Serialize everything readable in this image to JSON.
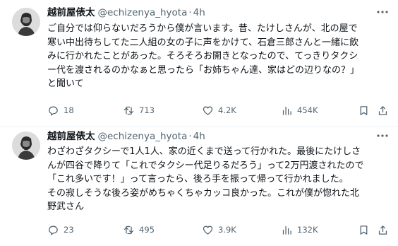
{
  "tweets": [
    {
      "author_name": "越前屋俵太",
      "handle": "@echizenya_hyota",
      "separator": "·",
      "time": "4h",
      "text": "ご自分では仰らないだろうから僕が言います。昔、たけしさんが、北の屋で\n寒い中出待ちしてた二人組の女の子に声をかけて、石倉三郎さんと一緒に飲\nみに行かれたことがあった。そろそろお開きとなったので、てっきりタクシ\nー代を渡されるのかなぁと思ったら「お姉ちゃん達、家はどの辺りなの？」\nと聞いて",
      "replies": "18",
      "reposts": "713",
      "likes": "4.2K",
      "views": "454K"
    },
    {
      "author_name": "越前屋俵太",
      "handle": "@echizenya_hyota",
      "separator": "·",
      "time": "4h",
      "text": "わざわざタクシーで1人1人、家の近くまで送って行かれた。最後にたけしさ\nんが四谷で降りて「これでタクシー代足りるだろう」って2万円渡されたので\n「これ多いです！」って言ったら、後ろ手を振って帰って行かれました。\nその寂しそうな後ろ姿がめちゃくちゃカッコ良かった。これが僕が惚れた北\n野武さん",
      "replies": "23",
      "reposts": "495",
      "likes": "3.9K",
      "views": "132K"
    }
  ],
  "icons": {
    "reply": "reply-icon",
    "repost": "repost-icon",
    "like": "heart-icon",
    "views": "views-icon",
    "bookmark": "bookmark-icon",
    "share": "share-icon",
    "more": "more-icon"
  },
  "colors": {
    "text": "#0f1419",
    "secondary": "#536471",
    "divider": "#eff3f4"
  }
}
